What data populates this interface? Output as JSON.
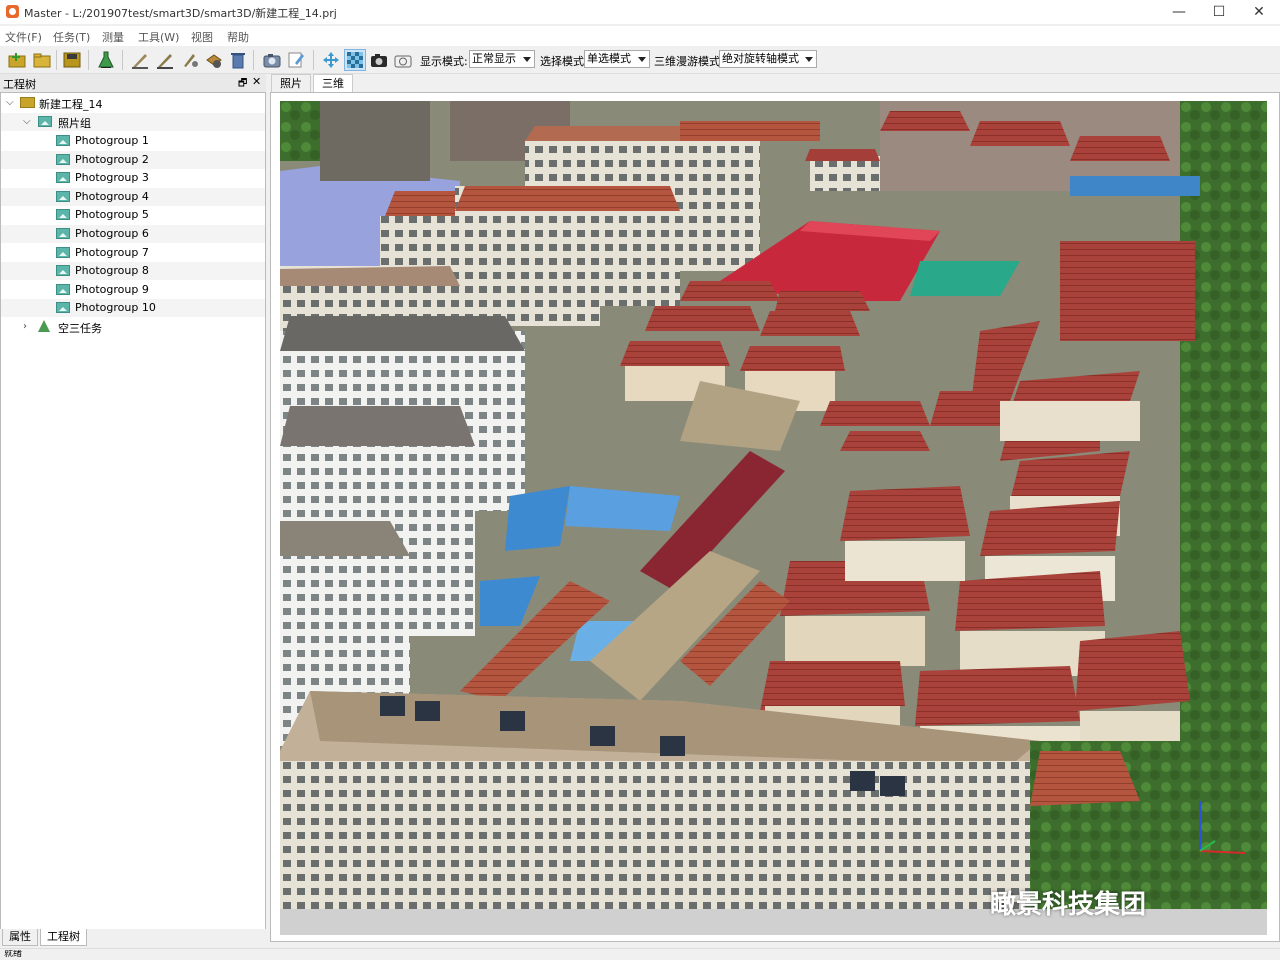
{
  "app": {
    "title": "Master - L:/201907test/smart3D/smart3D/新建工程_14.prj",
    "icon": "app-logo-icon",
    "accent_color": "#e8682c"
  },
  "window_controls": {
    "minimize": "—",
    "maximize": "☐",
    "close": "✕"
  },
  "menu": [
    "文件(F)",
    "任务(T)",
    "测量",
    "工具(W)",
    "视图",
    "帮助"
  ],
  "toolbar": {
    "display_mode_label": "显示模式:",
    "display_mode_value": "正常显示",
    "select_mode_label": "选择模式",
    "select_mode_value": "单选模式",
    "navigate_mode_label": "三维漫游模式",
    "navigate_mode_value": "绝对旋转轴模式"
  },
  "tree": {
    "header": "工程树",
    "float_glyph": "🗗",
    "close_glyph": "✕",
    "project": "新建工程_14",
    "photo_group_folder": "照片组",
    "photogroups": [
      "Photogroup 1",
      "Photogroup 2",
      "Photogroup 3",
      "Photogroup 4",
      "Photogroup 5",
      "Photogroup 6",
      "Photogroup 7",
      "Photogroup 8",
      "Photogroup 9",
      "Photogroup 10"
    ],
    "aerial_task": "空三任务"
  },
  "bottom_tabs": [
    "属性",
    "工程树"
  ],
  "status": "就绪",
  "view_tabs": [
    "照片",
    "三维"
  ],
  "watermark": "瞰景科技集团"
}
